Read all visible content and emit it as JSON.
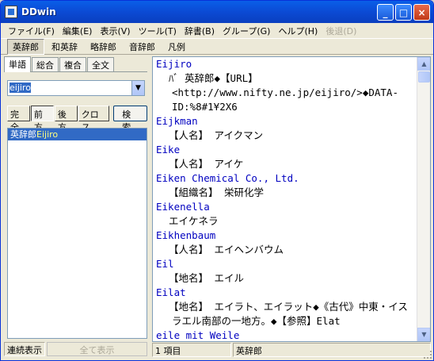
{
  "window": {
    "title": "DDwin"
  },
  "menu": [
    "ファイル(F)",
    "編集(E)",
    "表示(V)",
    "ツール(T)",
    "辞書(B)",
    "グループ(G)",
    "ヘルプ(H)",
    "後退(D)"
  ],
  "toolbar": [
    "英辞郎",
    "和英辞",
    "略辞郎",
    "音辞郎",
    "凡例"
  ],
  "tabs": [
    "単語",
    "総合",
    "複合",
    "全文"
  ],
  "search": {
    "value": "eijiro"
  },
  "modes": [
    "完全",
    "前方",
    "後方",
    "クロス"
  ],
  "search_button": "検索",
  "results": [
    {
      "dict": "英辞郎",
      "headword": "Eijiro"
    }
  ],
  "left_status": {
    "continuous": "連続表示",
    "show_all": "全て表示"
  },
  "entries": [
    {
      "head": "Eijiro",
      "body": "  ﾊﾞ  英辞郎◆【URL】<http://www.nifty.ne.jp/eijiro/>◆DATA-ID:%8#1¥2X6"
    },
    {
      "head": "Eijkman",
      "body": "【人名】 アイクマン"
    },
    {
      "head": "Eike",
      "body": "【人名】 アイケ"
    },
    {
      "head": "Eiken Chemical Co., Ltd.",
      "body": "【組織名】 栄研化学"
    },
    {
      "head": "Eikenella",
      "body": "エイケネラ"
    },
    {
      "head": "Eikhenbaum",
      "body": "【人名】 エイヘンバウム"
    },
    {
      "head": "Eil",
      "body": "【地名】 エイル"
    },
    {
      "head": "Eilat",
      "body": "【地名】 エイラト、エイラット◆《古代》中東・イスラエル南部の一地方。◆【参照】Elat"
    },
    {
      "head": "eile mit Weile",
      "body": ""
    }
  ],
  "status": {
    "count": "1 項目",
    "dict": "英辞郎"
  }
}
